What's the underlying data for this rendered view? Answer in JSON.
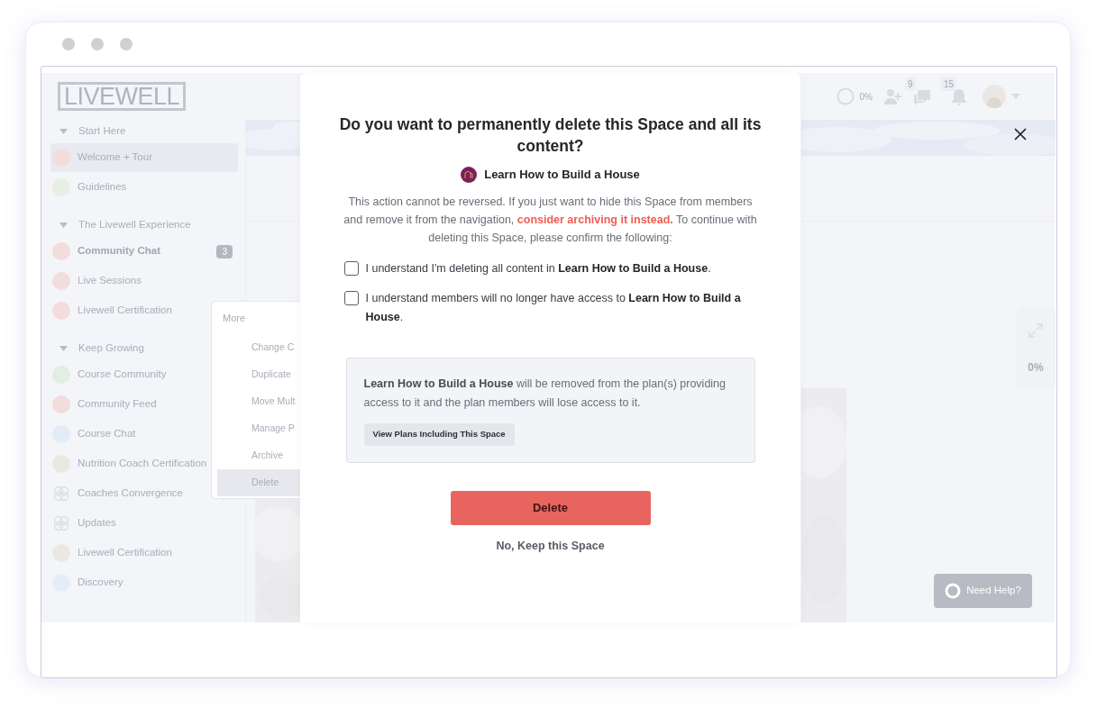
{
  "logo": "LIVEWELL",
  "header": {
    "progress": "0%",
    "chat_count": "9",
    "notification_count": "15"
  },
  "sidebar": {
    "sections": [
      {
        "title": "Start Here",
        "expanded": true,
        "items": [
          {
            "label": "Welcome + Tour",
            "selected": true,
            "color": "#f3dcdc"
          },
          {
            "label": "Guidelines",
            "selected": false,
            "color": "#e6efe4"
          }
        ]
      },
      {
        "title": "The Livewell Experience",
        "expanded": true,
        "items": [
          {
            "label": "Community Chat",
            "selected": false,
            "unread": true,
            "badge": "3",
            "color": "#f3dcdc"
          },
          {
            "label": "Live Sessions",
            "selected": false,
            "color": "#f3dcdc"
          },
          {
            "label": "Livewell Certification",
            "selected": false,
            "color": "#f3dcdc"
          }
        ]
      },
      {
        "title": "Keep Growing",
        "expanded": true,
        "items": [
          {
            "label": "Course Community",
            "selected": false,
            "color": "#e3ede4"
          },
          {
            "label": "Community Feed",
            "selected": false,
            "color": "#f3dcdc"
          },
          {
            "label": "Course Chat",
            "selected": false,
            "color": "#e2ebf6"
          },
          {
            "label": "Nutrition Coach Certification",
            "selected": false,
            "color": "#ebe8e3"
          },
          {
            "label": "Coaches Convergence",
            "selected": false,
            "menu": true
          },
          {
            "label": "Updates",
            "selected": false
          },
          {
            "label": "Livewell Certification",
            "selected": false,
            "color": "#ebe8e3"
          },
          {
            "label": "Discovery",
            "selected": false,
            "color": "#e7edf6"
          }
        ]
      }
    ]
  },
  "context_menu": {
    "title": "More",
    "items": [
      {
        "label": "Change C",
        "selected": false
      },
      {
        "label": "Duplicate",
        "selected": false
      },
      {
        "label": "Move Mult",
        "selected": false
      },
      {
        "label": "Manage P",
        "selected": false
      },
      {
        "label": "Archive",
        "selected": false
      },
      {
        "label": "Delete",
        "selected": true
      }
    ]
  },
  "side_panel": {
    "progress": "0%"
  },
  "help_button": "Need Help?",
  "modal": {
    "title": "Do you want to permanently delete this Space and all its content?",
    "space_name": "Learn How to Build a House",
    "description": {
      "before": "This action cannot be reversed. If you just want to hide this Space from members and remove it from the navigation,",
      "link": "consider archiving it instead.",
      "after": "To continue with deleting this Space, please confirm the following:"
    },
    "checks": [
      {
        "label": "I understand I'm deleting all content in **Learn How to Build a House**.",
        "checked": false
      },
      {
        "label": "I understand members will no longer have access to **Learn How to Build a House**.",
        "checked": false
      }
    ],
    "info": "**Learn How to Build a House** will be removed from the plan(s) providing access to it and the plan members will lose access to it.",
    "info_button": "View Plans Including This Space",
    "delete_button": "Delete",
    "cancel": "No, Keep this Space"
  }
}
